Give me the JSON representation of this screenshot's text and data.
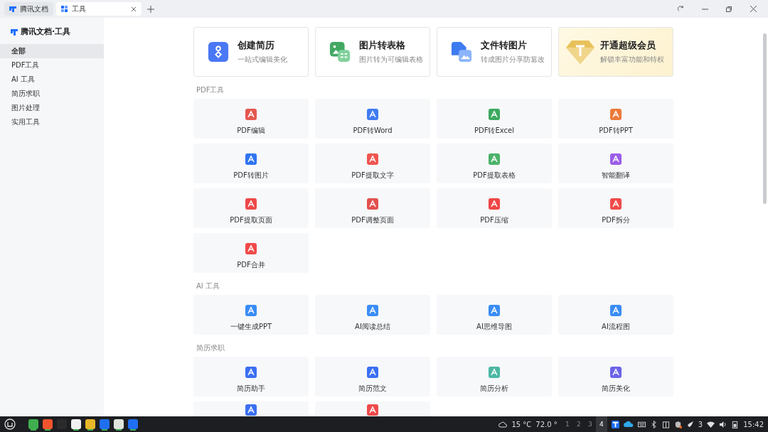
{
  "tabs": [
    {
      "label": "腾讯文档",
      "selected": false,
      "closable": false
    },
    {
      "label": "工具",
      "selected": true,
      "closable": true
    }
  ],
  "sidebar": {
    "brand": "腾讯文档·工具",
    "items": [
      {
        "label": "全部",
        "selected": true
      },
      {
        "label": "PDF工具",
        "selected": false
      },
      {
        "label": "AI 工具",
        "selected": false
      },
      {
        "label": "简历求职",
        "selected": false
      },
      {
        "label": "图片处理",
        "selected": false
      },
      {
        "label": "实用工具",
        "selected": false
      }
    ]
  },
  "featured": [
    {
      "title": "创建简历",
      "subtitle": "一站式编辑美化",
      "kind": "resume"
    },
    {
      "title": "图片转表格",
      "subtitle": "图片转为可编辑表格",
      "kind": "table"
    },
    {
      "title": "文件转图片",
      "subtitle": "转成图片分享防篡改",
      "kind": "image"
    },
    {
      "title": "开通超级会员",
      "subtitle": "解锁丰富功能和特权",
      "kind": "premium"
    }
  ],
  "sections": [
    {
      "title": "PDF工具",
      "tools": [
        {
          "label": "PDF编辑",
          "color": "#e5574f"
        },
        {
          "label": "PDF转Word",
          "color": "#3f7cf2"
        },
        {
          "label": "PDF转Excel",
          "color": "#3daa5f"
        },
        {
          "label": "PDF转PPT",
          "color": "#ec7a3a"
        },
        {
          "label": "PDF转图片",
          "color": "#2f74f0"
        },
        {
          "label": "PDF提取文字",
          "color": "#ef5550"
        },
        {
          "label": "PDF提取表格",
          "color": "#4bb269"
        },
        {
          "label": "智能翻译",
          "color": "#9b5de8"
        },
        {
          "label": "PDF提取页面",
          "color": "#ee4848"
        },
        {
          "label": "PDF调整页面",
          "color": "#e2514d"
        },
        {
          "label": "PDF压缩",
          "color": "#ef4646"
        },
        {
          "label": "PDF拆分",
          "color": "#f04a4a"
        },
        {
          "label": "PDF合并",
          "color": "#ef4a4a"
        }
      ]
    },
    {
      "title": "AI 工具",
      "tools": [
        {
          "label": "一键生成PPT",
          "color": "#3a8df5"
        },
        {
          "label": "AI阅读总结",
          "color": "#3a8df5"
        },
        {
          "label": "AI思维导图",
          "color": "#3a8df5"
        },
        {
          "label": "AI流程图",
          "color": "#3a8df5"
        }
      ]
    },
    {
      "title": "简历求职",
      "tools": [
        {
          "label": "简历助手",
          "color": "#3b6ff2"
        },
        {
          "label": "简历范文",
          "color": "#3b6ff2"
        },
        {
          "label": "简历分析",
          "color": "#4cb8a3"
        },
        {
          "label": "简历美化",
          "color": "#6b63e8"
        },
        {
          "color": "#3b6ff2"
        },
        {
          "color": "#ef4a4a"
        }
      ]
    }
  ],
  "taskbar": {
    "apps": [
      {
        "color": "#3fae4f",
        "running": true
      },
      {
        "color": "#f2542d",
        "running": true
      },
      {
        "color": "#2b2b2b",
        "running": false
      },
      {
        "color": "#f1f1f1",
        "running": true
      },
      {
        "color": "#e8b62b",
        "running": true
      },
      {
        "color": "#1f6ff2",
        "running": true
      },
      {
        "color": "#dfe5dc",
        "running": true
      },
      {
        "color": "#1f6ff2",
        "running": true
      }
    ],
    "weather": "15 °C",
    "reading": "72.0 °",
    "workspaces": [
      {
        "label": "1",
        "selected": false
      },
      {
        "label": "2",
        "selected": false
      },
      {
        "label": "3",
        "selected": false
      },
      {
        "label": "4",
        "selected": true
      }
    ],
    "notifications": "3",
    "clock": "15:42"
  }
}
